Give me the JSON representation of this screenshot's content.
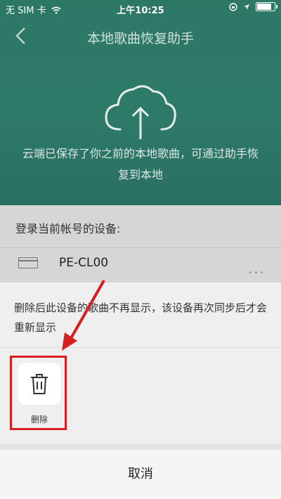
{
  "status_bar": {
    "carrier": "无 SIM 卡",
    "time": "上午10:25"
  },
  "nav": {
    "title": "本地歌曲恢复助手"
  },
  "intro": {
    "text": "云端已保存了你之前的本地歌曲，可通过助手恢复到本地"
  },
  "panel": {
    "heading": "登录当前帐号的设备:",
    "device_name": "PE-CL00",
    "more": "..."
  },
  "sheet": {
    "description": "删除后此设备的歌曲不再显示，该设备再次同步后才会重新显示",
    "action_label": "删除",
    "cancel_label": "取消"
  },
  "colors": {
    "accent": "#2e7a69",
    "highlight": "#d81e1e"
  },
  "icons": [
    "back-icon",
    "cloud-upload-icon",
    "device-icon",
    "more-icon",
    "trash-icon",
    "wifi-icon",
    "location-icon",
    "battery-icon"
  ]
}
